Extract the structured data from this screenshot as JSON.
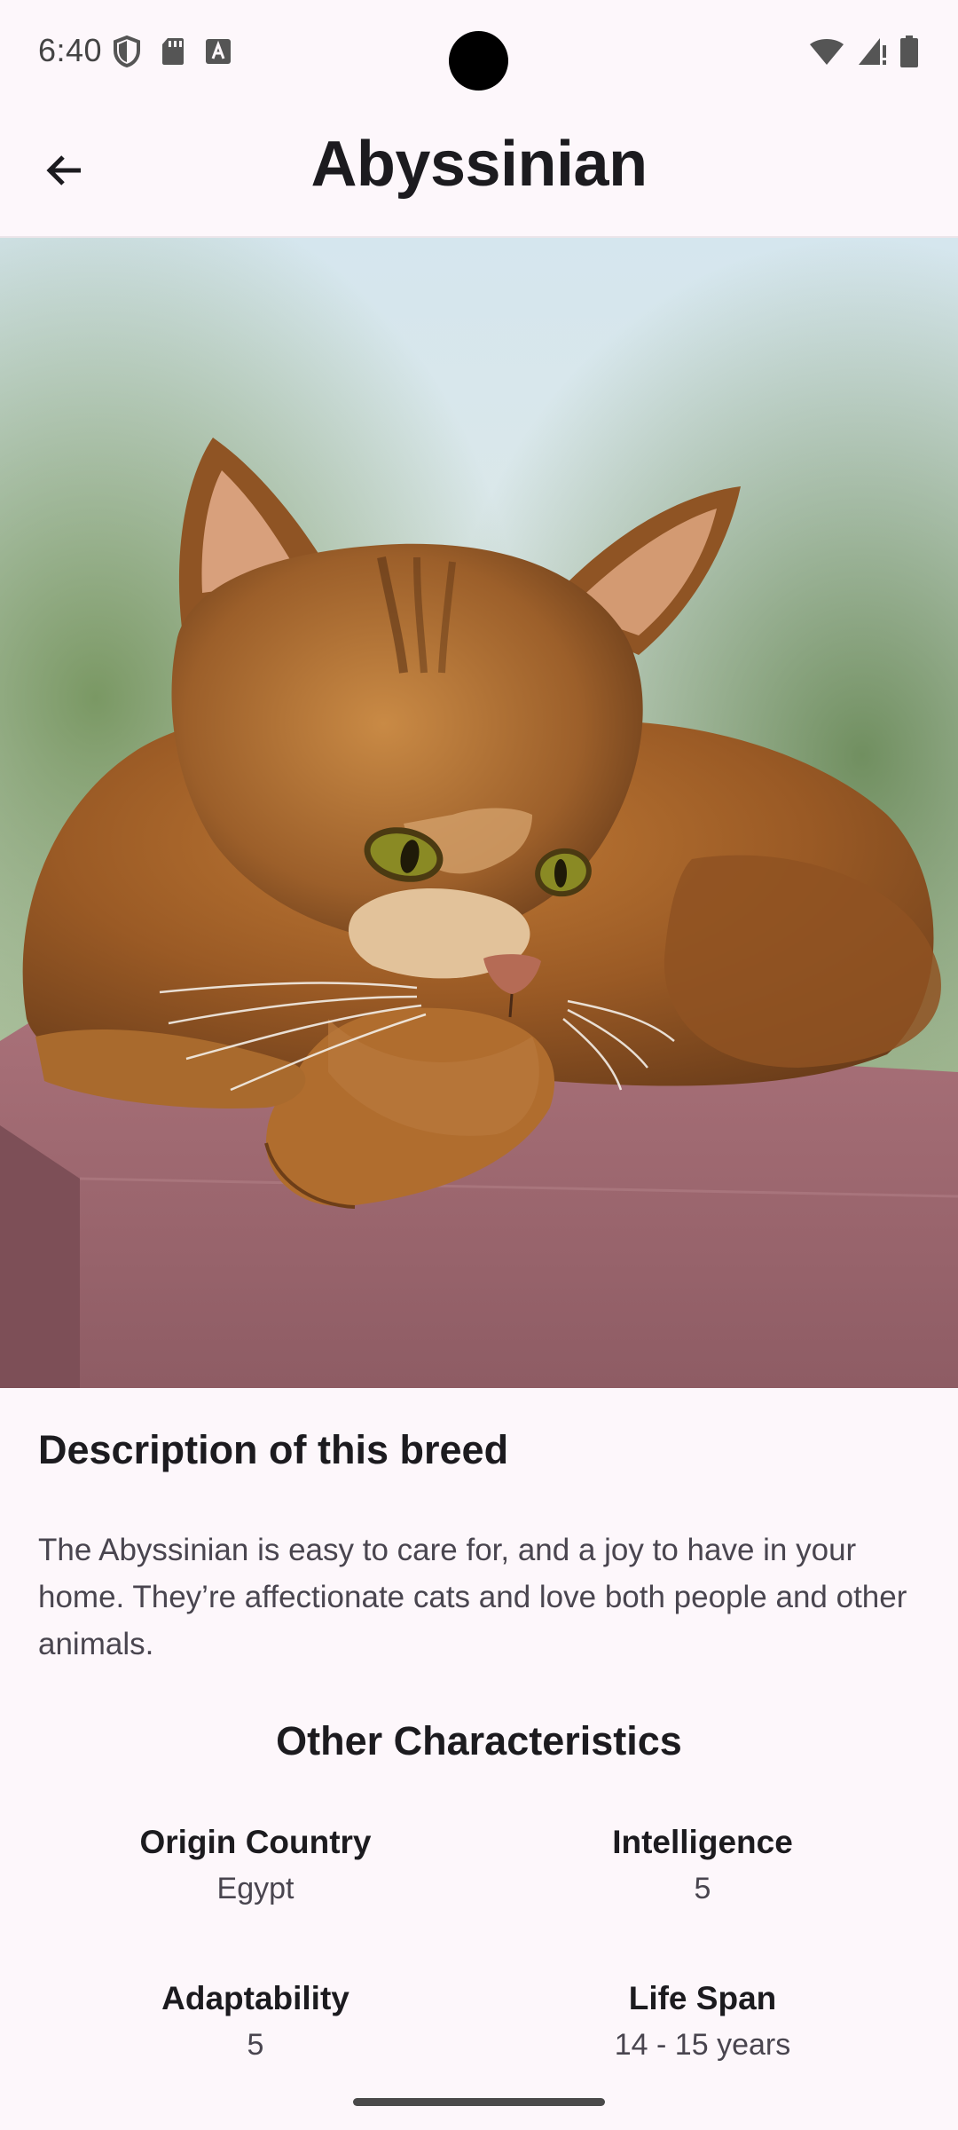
{
  "status_bar": {
    "time": "6:40",
    "icons": [
      "shield-icon",
      "sd-card-icon",
      "text-a-icon",
      "wifi-icon",
      "cell-signal-icon",
      "battery-icon"
    ]
  },
  "app_bar": {
    "title": "Abyssinian",
    "back_icon": "arrow-back-icon"
  },
  "hero": {
    "subject": "abyssinian-cat-photo"
  },
  "description": {
    "heading": "Description of this breed",
    "text": "The Abyssinian is easy to care for, and a joy to have in your home. They’re affectionate cats and love both people and other animals."
  },
  "characteristics": {
    "heading": "Other Characteristics",
    "items": [
      {
        "label": "Origin Country",
        "value": "Egypt"
      },
      {
        "label": "Intelligence",
        "value": "5"
      },
      {
        "label": "Adaptability",
        "value": "5"
      },
      {
        "label": "Life Span",
        "value": "14 - 15 years"
      }
    ]
  },
  "colors": {
    "background": "#fdf7fb",
    "text_primary": "#1c1b1f",
    "text_secondary": "#49454f"
  }
}
